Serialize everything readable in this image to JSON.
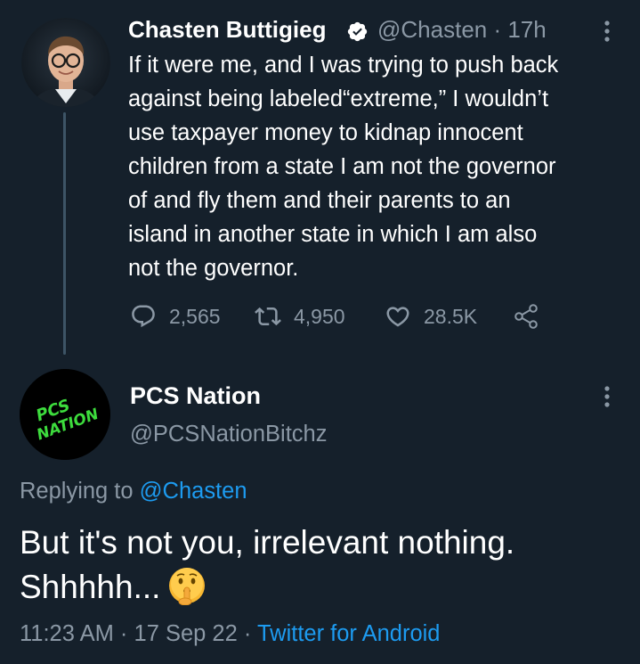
{
  "parent_tweet": {
    "author_name": "Chasten Buttigieg",
    "handle_time": "@Chasten · 17h",
    "text": "If it were me, and I was trying to push back\nagainst being labeled“extreme,” I wouldn’t\nuse taxpayer money to kidnap innocent\nchildren from a state I am not the governor\nof and fly them and their parents to an\nisland in another state in which I am also\nnot the governor.",
    "replies": "2,565",
    "retweets": "4,950",
    "likes": "28.5K"
  },
  "reply_tweet": {
    "author_name": "PCS Nation",
    "handle": "@PCSNationBitchz",
    "avatar_text_1": "PCS",
    "avatar_text_2": "NATION",
    "replying_prefix": "Replying to ",
    "replying_handle": "@Chasten",
    "text_line1": "But it's not you, irrelevant nothing.",
    "text_line2": "Shhhhh...",
    "timestamp": "11:23 AM · 17 Sep 22 · ",
    "source": "Twitter for Android"
  },
  "colors": {
    "background": "#15202b",
    "text": "#ffffff",
    "muted": "#8b98a5",
    "accent": "#1d9bf0",
    "avatar_logo": "#3ddc3d"
  },
  "icons": [
    "verified-badge-icon",
    "more-options-icon",
    "reply-icon",
    "retweet-icon",
    "like-icon",
    "share-icon",
    "shushing-face-emoji"
  ]
}
